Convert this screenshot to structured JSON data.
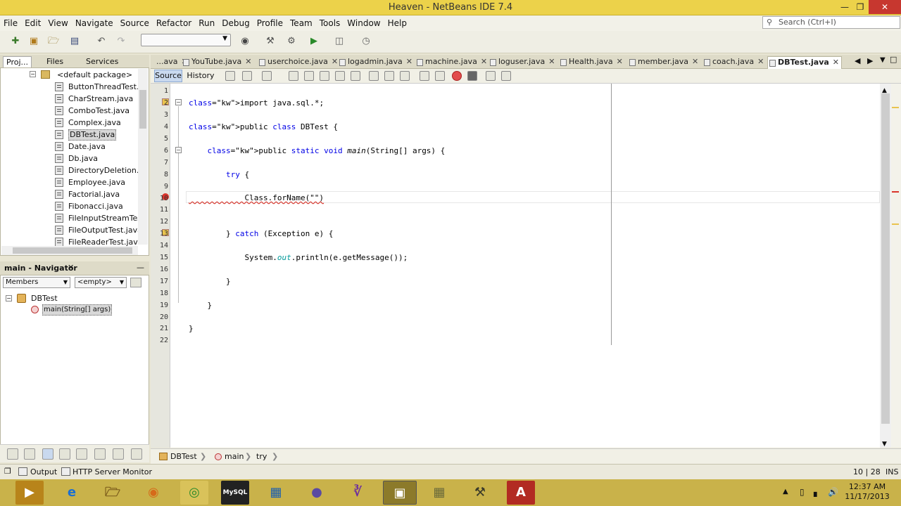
{
  "window": {
    "title": "Heaven - NetBeans IDE 7.4"
  },
  "menu": [
    "File",
    "Edit",
    "View",
    "Navigate",
    "Source",
    "Refactor",
    "Run",
    "Debug",
    "Profile",
    "Team",
    "Tools",
    "Window",
    "Help"
  ],
  "search": {
    "placeholder": "Search (Ctrl+I)"
  },
  "left_tabs": [
    "Proj...",
    "Files",
    "Services"
  ],
  "project_tree": {
    "package": "<default package>",
    "files": [
      "ButtonThreadTest.jav",
      "CharStream.java",
      "ComboTest.java",
      "Complex.java",
      "DBTest.java",
      "Date.java",
      "Db.java",
      "DirectoryDeletion.jav",
      "Employee.java",
      "Factorial.java",
      "Fibonacci.java",
      "FileInputStreamTest.j",
      "FileOutputTest.java",
      "FileReaderTest.java"
    ],
    "selected": "DBTest.java"
  },
  "navigator": {
    "title": "main - Navigator",
    "filter": "Members",
    "scope": "<empty>",
    "root": "DBTest",
    "member": "main(String[] args)"
  },
  "editor_tabs": [
    "...ava",
    "YouTube.java",
    "userchoice.java",
    "logadmin.java",
    "machine.java",
    "loguser.java",
    "Health.java",
    "member.java",
    "coach.java",
    "DBTest.java"
  ],
  "active_tab": "DBTest.java",
  "editor_toolbar": {
    "source": "Source",
    "history": "History"
  },
  "code_lines": [
    {
      "n": "1",
      "text": ""
    },
    {
      "n": "2",
      "text": "import java.sql.*;"
    },
    {
      "n": "3",
      "text": ""
    },
    {
      "n": "4",
      "text": "public class DBTest {"
    },
    {
      "n": "5",
      "text": ""
    },
    {
      "n": "6",
      "text": "    public static void main(String[] args) {"
    },
    {
      "n": "7",
      "text": ""
    },
    {
      "n": "8",
      "text": "        try {"
    },
    {
      "n": "9",
      "text": ""
    },
    {
      "n": "10",
      "text": "            Class.forName(\"\")"
    },
    {
      "n": "11",
      "text": ""
    },
    {
      "n": "12",
      "text": ""
    },
    {
      "n": "13",
      "text": "        } catch (Exception e) {"
    },
    {
      "n": "14",
      "text": ""
    },
    {
      "n": "15",
      "text": "            System.out.println(e.getMessage());"
    },
    {
      "n": "16",
      "text": ""
    },
    {
      "n": "17",
      "text": "        }"
    },
    {
      "n": "18",
      "text": ""
    },
    {
      "n": "19",
      "text": "    }"
    },
    {
      "n": "20",
      "text": ""
    },
    {
      "n": "21",
      "text": "}"
    },
    {
      "n": "22",
      "text": ""
    }
  ],
  "breadcrumbs": [
    "DBTest",
    "main",
    "try"
  ],
  "bottom_tabs": {
    "output": "Output",
    "http": "HTTP Server Monitor"
  },
  "status": {
    "position": "10 | 28",
    "mode": "INS"
  },
  "clock": {
    "time": "12:37 AM",
    "date": "11/17/2013"
  },
  "colors": {
    "titlebar": "#ecd24a",
    "taskbar": "#c9b24a",
    "keyword": "#0000e6",
    "error": "#d9342b"
  }
}
